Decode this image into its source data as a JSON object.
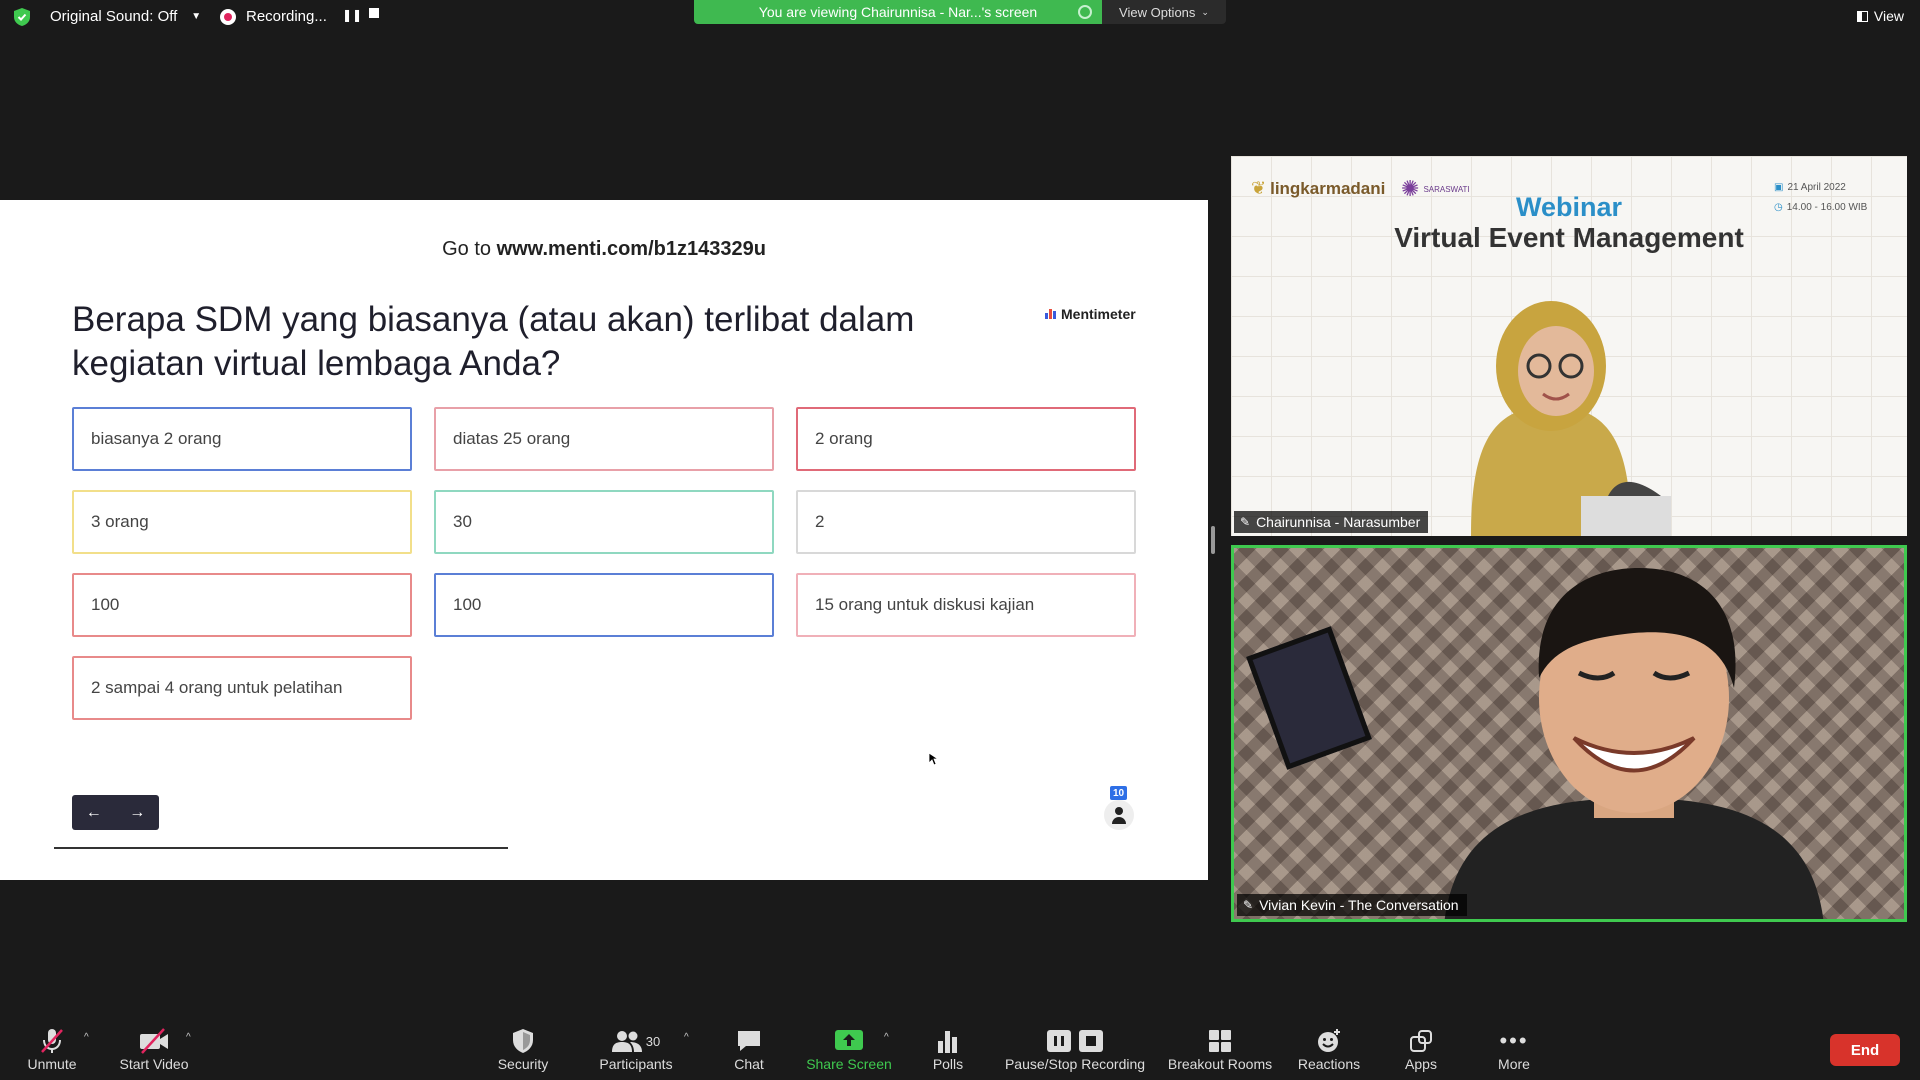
{
  "topbar": {
    "original_sound": "Original Sound: Off",
    "recording": "Recording...",
    "banner": "You are viewing Chairunnisa - Nar...'s screen",
    "view_options": "View Options",
    "view": "View"
  },
  "slide": {
    "goto_prefix": "Go to",
    "goto_url": "www.menti.com/b1z143329u",
    "question": "Berapa SDM yang biasanya (atau akan) terlibat dalam kegiatan virtual lembaga Anda?",
    "brand": "Mentimeter",
    "responses": [
      {
        "text": "biasanya 2 orang",
        "color": "#5b7fd6"
      },
      {
        "text": "diatas 25 orang",
        "color": "#e8a0a8"
      },
      {
        "text": "2 orang",
        "color": "#e06a78"
      },
      {
        "text": "3 orang",
        "color": "#f2df8a"
      },
      {
        "text": "30",
        "color": "#8fd8c0"
      },
      {
        "text": "2",
        "color": "#d8d8d8"
      },
      {
        "text": "100",
        "color": "#e88a8a"
      },
      {
        "text": "100",
        "color": "#5b7fd6"
      },
      {
        "text": "15 orang untuk diskusi kajian",
        "color": "#f0b0b8"
      },
      {
        "text": "2 sampai 4 orang untuk pelatihan",
        "color": "#e88a8a"
      }
    ],
    "nav_prev": "←",
    "nav_next": "→",
    "audience_count": "10"
  },
  "videos": {
    "tile1": {
      "name": "Chairunnisa - Narasumber",
      "logo1": "lingkarmadani",
      "logo2": "SARASWATI",
      "title_top": "Webinar",
      "title_main": "Virtual Event Management",
      "date": "21 April 2022",
      "time": "14.00 - 16.00 WIB"
    },
    "tile2": {
      "name": "Vivian Kevin - The Conversation"
    }
  },
  "toolbar": {
    "unmute": "Unmute",
    "start_video": "Start Video",
    "security": "Security",
    "participants": "Participants",
    "participants_count": "30",
    "chat": "Chat",
    "share_screen": "Share Screen",
    "polls": "Polls",
    "pause_stop": "Pause/Stop Recording",
    "breakout": "Breakout Rooms",
    "reactions": "Reactions",
    "apps": "Apps",
    "more": "More",
    "end": "End"
  }
}
